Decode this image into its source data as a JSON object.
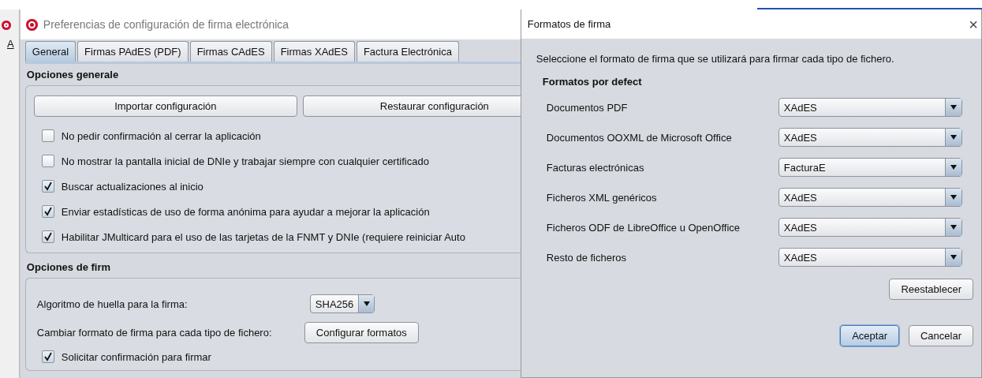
{
  "background_window": {
    "menu_letter": "A"
  },
  "main_window": {
    "title": "Preferencias de configuración de firma electrónica",
    "tabs": [
      {
        "label": "General",
        "selected": true
      },
      {
        "label": "Firmas PAdES (PDF)",
        "selected": false
      },
      {
        "label": "Firmas CAdES",
        "selected": false
      },
      {
        "label": "Firmas XAdES",
        "selected": false
      },
      {
        "label": "Factura Electrónica",
        "selected": false
      }
    ],
    "general_section": {
      "heading": "Opciones generale",
      "buttons": [
        "Importar configuración",
        "Restaurar configuración"
      ],
      "options": [
        {
          "label": "No pedir confirmación al cerrar la aplicación",
          "checked": false
        },
        {
          "label": "No mostrar la pantalla inicial de DNIe y trabajar siempre con cualquier certificado",
          "checked": false
        },
        {
          "label": "Buscar actualizaciones al inicio",
          "checked": true
        },
        {
          "label": "Enviar estadísticas de uso de forma anónima para ayudar a mejorar la aplicación",
          "checked": true
        },
        {
          "label": "Habilitar JMulticard para el uso de las tarjetas de la FNMT y DNIe (requiere reiniciar Auto",
          "checked": true
        }
      ]
    },
    "signature_section": {
      "heading": "Opciones de firm",
      "algorithm": {
        "label": "Algoritmo de huella para la firma:",
        "value": "SHA256"
      },
      "formats": {
        "label": "Cambiar formato de firma para cada tipo de fichero:",
        "button": "Configurar formatos"
      },
      "options": [
        {
          "label": "Solicitar confirmación para firmar",
          "checked": true
        }
      ]
    }
  },
  "dialog": {
    "title": "Formatos de firma",
    "close": "×",
    "intro": "Seleccione el formato de firma que se utilizará para firmar cada tipo de fichero.",
    "heading": "Formatos por defect",
    "rows": [
      {
        "label": "Documentos PDF",
        "value": "XAdES"
      },
      {
        "label": "Documentos OOXML de Microsoft Office",
        "value": "XAdES"
      },
      {
        "label": "Facturas electrónicas",
        "value": "FacturaE"
      },
      {
        "label": "Ficheros XML genéricos",
        "value": "XAdES"
      },
      {
        "label": "Ficheros ODF de LibreOffice u OpenOffice",
        "value": "XAdES"
      },
      {
        "label": "Resto de ficheros",
        "value": "XAdES"
      }
    ],
    "reset_button": "Reestablecer",
    "buttons": [
      {
        "label": "Aceptar",
        "selected": true
      },
      {
        "label": "Cancelar",
        "selected": false
      }
    ]
  }
}
